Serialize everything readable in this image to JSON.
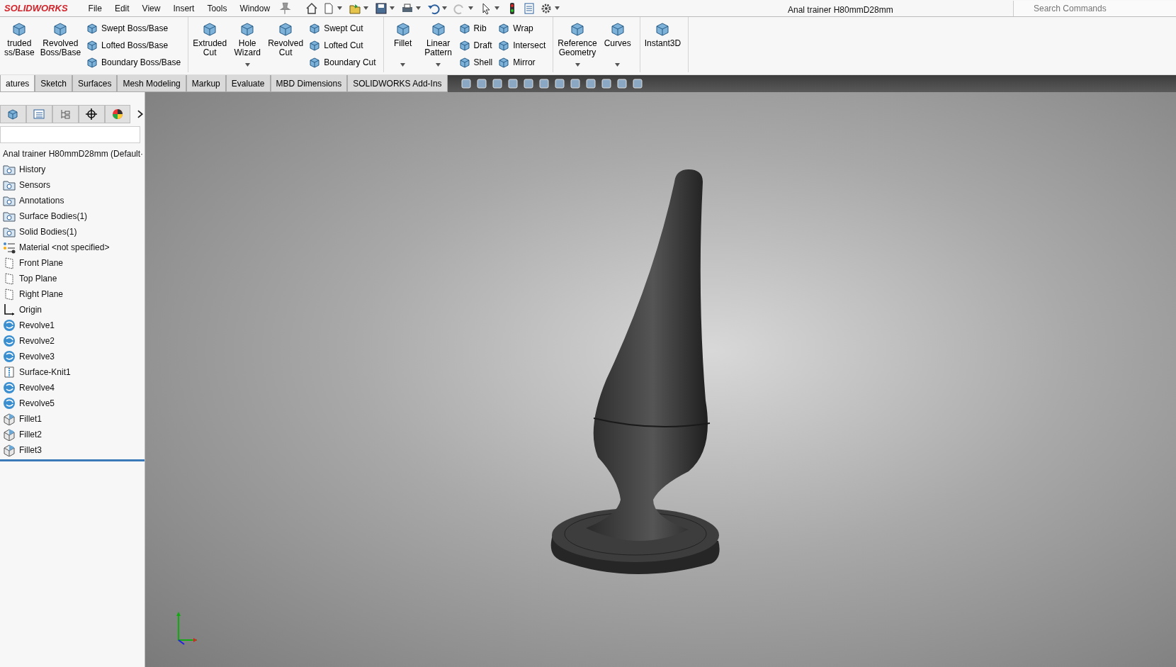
{
  "app_name": "SOLIDWORKS",
  "menu": [
    "File",
    "Edit",
    "View",
    "Insert",
    "Tools",
    "Window"
  ],
  "window": {
    "title": "Anal trainer H80mmD28mm"
  },
  "search": {
    "placeholder": "Search Commands"
  },
  "ribbon": {
    "groups": [
      {
        "columns": [
          {
            "kind": "large",
            "lines": [
              "truded",
              "ss/Base"
            ],
            "dropdown": false
          },
          {
            "kind": "large",
            "lines": [
              "Revolved",
              "Boss/Base"
            ],
            "dropdown": false
          },
          {
            "kind": "stack",
            "items": [
              "Swept Boss/Base",
              "Lofted Boss/Base",
              "Boundary Boss/Base"
            ]
          }
        ]
      },
      {
        "columns": [
          {
            "kind": "large",
            "lines": [
              "Extruded",
              "Cut"
            ],
            "dropdown": false
          },
          {
            "kind": "large",
            "lines": [
              "Hole",
              "Wizard"
            ],
            "dropdown": true
          },
          {
            "kind": "large",
            "lines": [
              "Revolved",
              "Cut"
            ],
            "dropdown": false
          },
          {
            "kind": "stack",
            "items": [
              "Swept Cut",
              "Lofted Cut",
              "Boundary Cut"
            ]
          }
        ]
      },
      {
        "columns": [
          {
            "kind": "large",
            "lines": [
              "Fillet"
            ],
            "dropdown": true
          },
          {
            "kind": "large",
            "lines": [
              "Linear",
              "Pattern"
            ],
            "dropdown": true
          },
          {
            "kind": "stack",
            "items": [
              "Rib",
              "Draft",
              "Shell"
            ]
          },
          {
            "kind": "stack",
            "items": [
              "Wrap",
              "Intersect",
              "Mirror"
            ]
          }
        ]
      },
      {
        "columns": [
          {
            "kind": "large",
            "lines": [
              "Reference",
              "Geometry"
            ],
            "dropdown": true
          },
          {
            "kind": "large",
            "lines": [
              "Curves"
            ],
            "dropdown": true
          }
        ]
      },
      {
        "columns": [
          {
            "kind": "large",
            "lines": [
              "Instant3D"
            ],
            "dropdown": false
          }
        ]
      }
    ]
  },
  "tabs": [
    {
      "label": "atures",
      "selected": true
    },
    {
      "label": "Sketch",
      "selected": false
    },
    {
      "label": "Surfaces",
      "selected": false
    },
    {
      "label": "Mesh Modeling",
      "selected": false
    },
    {
      "label": "Markup",
      "selected": false
    },
    {
      "label": "Evaluate",
      "selected": false
    },
    {
      "label": "MBD Dimensions",
      "selected": false
    },
    {
      "label": "SOLIDWORKS Add-Ins",
      "selected": false
    }
  ],
  "tree": {
    "root": "Anal trainer H80mmD28mm  (Default·",
    "items": [
      {
        "kind": "folder",
        "label": "History"
      },
      {
        "kind": "folder",
        "label": "Sensors"
      },
      {
        "kind": "folder",
        "label": "Annotations"
      },
      {
        "kind": "folder",
        "label": "Surface Bodies(1)"
      },
      {
        "kind": "folder",
        "label": "Solid Bodies(1)"
      },
      {
        "kind": "material",
        "label": "Material <not specified>"
      },
      {
        "kind": "plane",
        "label": "Front Plane"
      },
      {
        "kind": "plane",
        "label": "Top Plane"
      },
      {
        "kind": "plane",
        "label": "Right Plane"
      },
      {
        "kind": "origin",
        "label": "Origin"
      },
      {
        "kind": "revolve",
        "label": "Revolve1"
      },
      {
        "kind": "revolve",
        "label": "Revolve2"
      },
      {
        "kind": "revolve",
        "label": "Revolve3"
      },
      {
        "kind": "knit",
        "label": "Surface-Knit1"
      },
      {
        "kind": "revolve",
        "label": "Revolve4"
      },
      {
        "kind": "revolve",
        "label": "Revolve5"
      },
      {
        "kind": "fillet",
        "label": "Fillet1"
      },
      {
        "kind": "fillet",
        "label": "Fillet2"
      },
      {
        "kind": "fillet",
        "label": "Fillet3"
      }
    ]
  }
}
